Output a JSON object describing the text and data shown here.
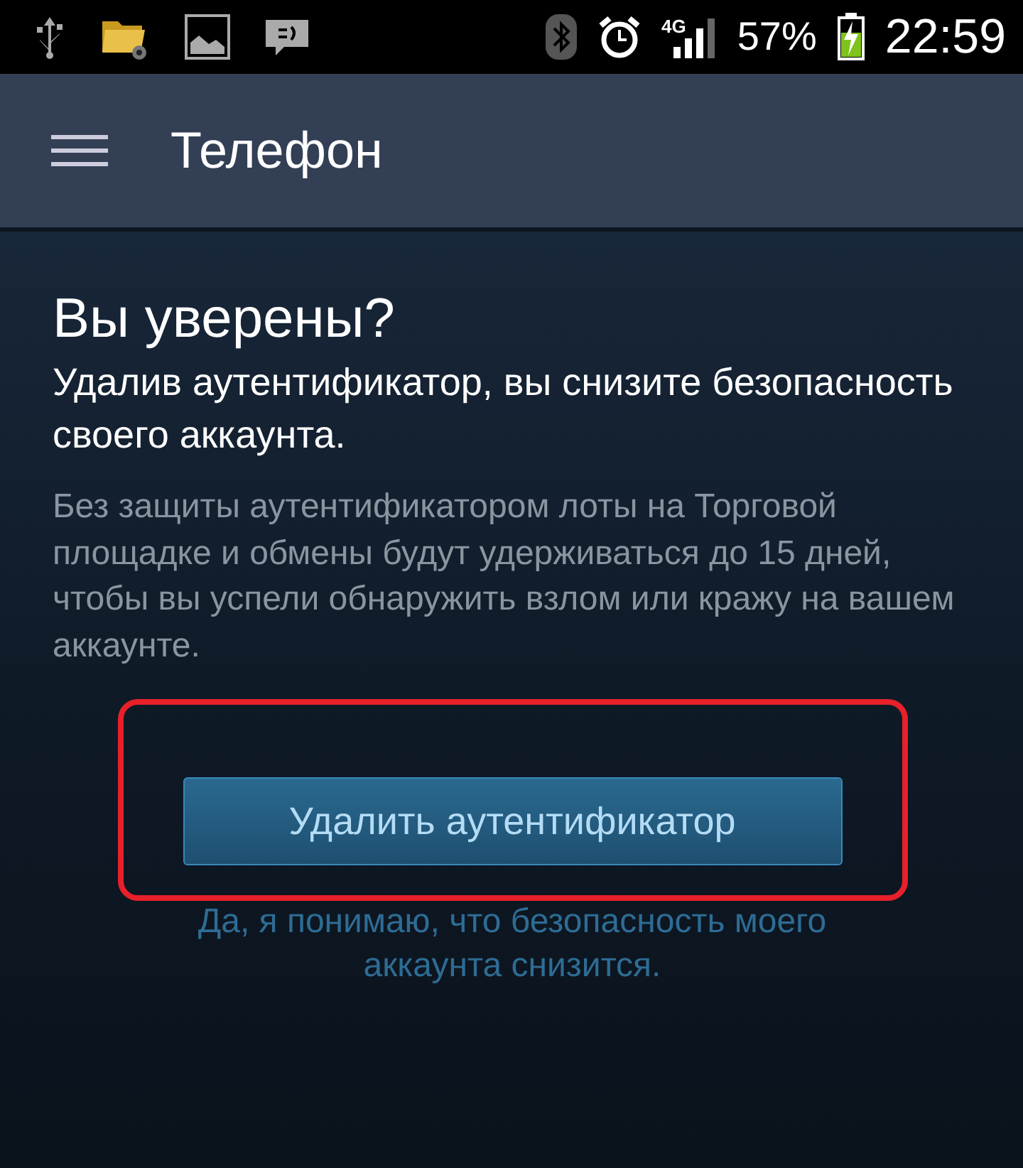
{
  "status_bar": {
    "network": "4G",
    "battery": "57%",
    "time": "22:59"
  },
  "app_bar": {
    "title": "Телефон"
  },
  "content": {
    "heading": "Вы уверены?",
    "subheading": "Удалив аутентификатор, вы снизите безопасность своего аккаунта.",
    "body": "Без защиты аутентификатором лоты на Торговой площадке и обмены будут удерживаться до 15 дней, чтобы вы успели обнаружить взлом или кражу на вашем аккаунте.",
    "button": "Удалить аутентификатор",
    "highlighted": true,
    "note": "Да, я понимаю, что безопасность моего аккаунта снизится."
  }
}
